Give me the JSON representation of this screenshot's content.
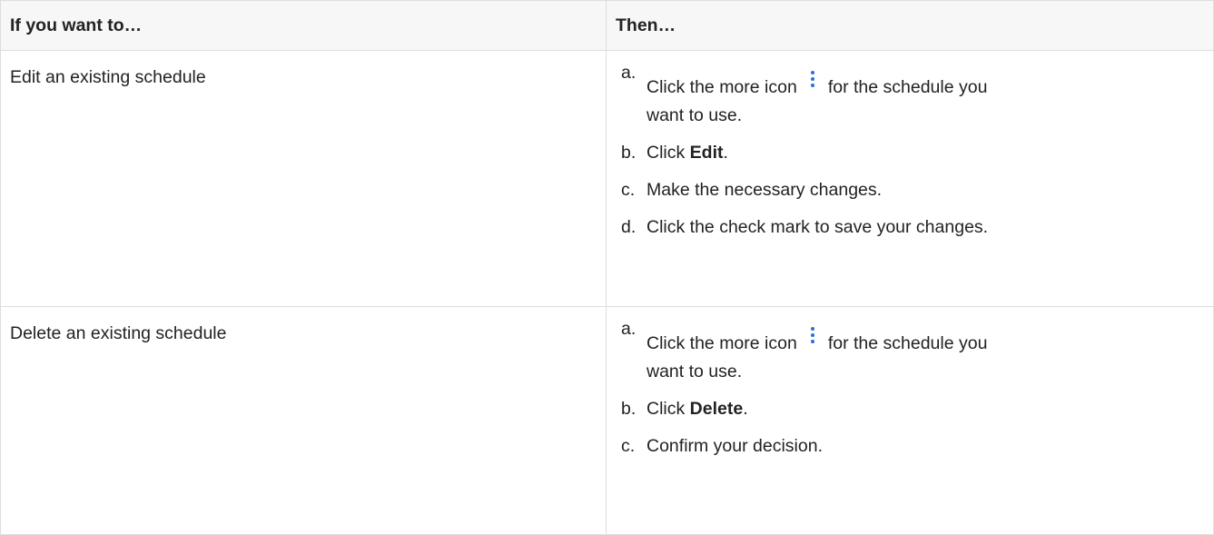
{
  "table": {
    "headers": [
      "If you want to…",
      "Then…"
    ],
    "rows": [
      {
        "label": "Edit an existing schedule",
        "steps": [
          {
            "letter": "a.",
            "before": "Click the more icon",
            "icon": "more-icon",
            "after": "for the schedule you",
            "line2": "want to use."
          },
          {
            "letter": "b.",
            "before": "Click ",
            "bold": "Edit",
            "after": "."
          },
          {
            "letter": "c.",
            "text": "Make the necessary changes."
          },
          {
            "letter": "d.",
            "text": "Click the check mark to save your changes."
          }
        ]
      },
      {
        "label": "Delete an existing schedule",
        "steps": [
          {
            "letter": "a.",
            "before": "Click the more icon",
            "icon": "more-icon",
            "after": "for the schedule you",
            "line2": "want to use."
          },
          {
            "letter": "b.",
            "before": "Click ",
            "bold": "Delete",
            "after": "."
          },
          {
            "letter": "c.",
            "text": "Confirm your decision."
          }
        ]
      }
    ]
  },
  "colors": {
    "border": "#dedede",
    "header_bg": "#f7f7f7",
    "icon": "#2a6fd8"
  }
}
